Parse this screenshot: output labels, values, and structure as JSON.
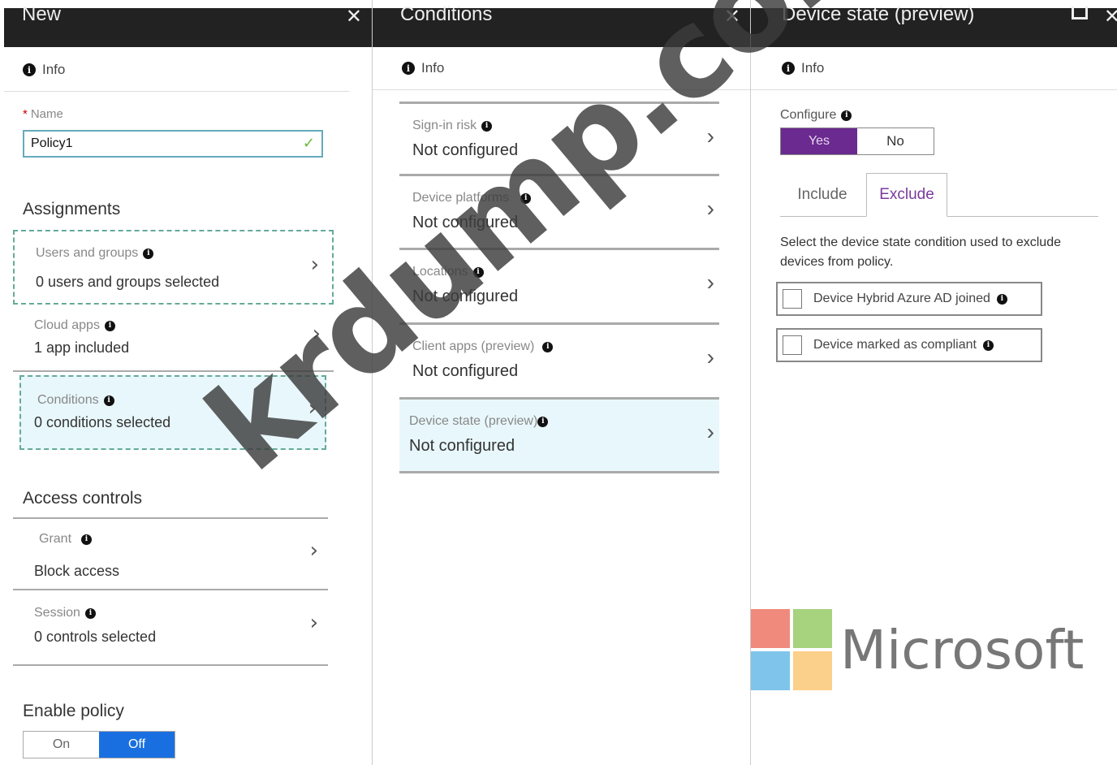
{
  "blade_new": {
    "title": "New",
    "info": "Info",
    "name_label": "Name",
    "name_value": "Policy1",
    "assignments_title": "Assignments",
    "assignments": [
      {
        "label": "Users and groups",
        "value": "0 users and groups selected"
      },
      {
        "label": "Cloud apps",
        "value": "1 app included"
      },
      {
        "label": "Conditions",
        "value": "0  conditions  selected"
      }
    ],
    "access_title": "Access controls",
    "access": [
      {
        "label": "Grant",
        "value": "Block access"
      },
      {
        "label": "Session",
        "value": "0 controls selected"
      }
    ],
    "enable_title": "Enable policy",
    "toggle_on": "On",
    "toggle_off": "Off"
  },
  "blade_conditions": {
    "title": "Conditions",
    "info": "Info",
    "items": [
      {
        "label": "Sign-in risk",
        "value": "Not configured"
      },
      {
        "label": "Device platforms",
        "value": "Not configured"
      },
      {
        "label": "Locations",
        "value": "Not configured"
      },
      {
        "label": "Client apps (preview)",
        "value": "Not configured"
      },
      {
        "label": "Device state (preview)",
        "value": "Not configured"
      }
    ]
  },
  "blade_device_state": {
    "title": "Device state (preview)",
    "info": "Info",
    "configure_label": "Configure",
    "yes": "Yes",
    "no": "No",
    "tab_include": "Include",
    "tab_exclude": "Exclude",
    "description": "Select the device state condition used to exclude devices from policy.",
    "checkbox_hybrid": "Device Hybrid Azure AD joined",
    "checkbox_compliant": "Device marked as compliant"
  },
  "microsoft_logo": {
    "text": "Microsoft",
    "colors": [
      "#f25022",
      "#7fba00",
      "#00a4ef",
      "#ffb900"
    ]
  },
  "watermark": "krdump.com",
  "colors": {
    "header": "#222222",
    "accent_purple": "#6b2a8f",
    "toggle_blue": "#1a6fe0",
    "selected_bg": "#e8f7fb"
  }
}
